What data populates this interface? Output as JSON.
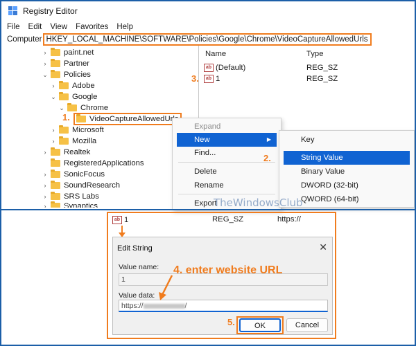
{
  "window": {
    "title": "Registry Editor"
  },
  "menubar": [
    "File",
    "Edit",
    "View",
    "Favorites",
    "Help"
  ],
  "address": {
    "label": "Computer",
    "path": "HKEY_LOCAL_MACHINE\\SOFTWARE\\Policies\\Google\\Chrome\\VideoCaptureAllowedUrls"
  },
  "tree": [
    {
      "label": "paint.net",
      "chev": "›"
    },
    {
      "label": "Partner",
      "chev": "›"
    },
    {
      "label": "Policies",
      "chev": "⌄"
    },
    {
      "label": "Adobe",
      "chev": "›"
    },
    {
      "label": "Google",
      "chev": "⌄"
    },
    {
      "label": "Chrome",
      "chev": "⌄"
    },
    {
      "label": "VideoCaptureAllowedUrls",
      "chev": ""
    },
    {
      "label": "Microsoft",
      "chev": "›"
    },
    {
      "label": "Mozilla",
      "chev": "›"
    },
    {
      "label": "Realtek",
      "chev": "›"
    },
    {
      "label": "RegisteredApplications",
      "chev": ""
    },
    {
      "label": "SonicFocus",
      "chev": "›"
    },
    {
      "label": "SoundResearch",
      "chev": "›"
    },
    {
      "label": "SRS Labs",
      "chev": "›"
    },
    {
      "label": "Synaptics",
      "chev": "›"
    }
  ],
  "values": {
    "headers": {
      "name": "Name",
      "type": "Type"
    },
    "rows": [
      {
        "name": "(Default)",
        "type": "REG_SZ"
      },
      {
        "name": "1",
        "type": "REG_SZ"
      }
    ]
  },
  "context_menu": {
    "items": [
      "Expand",
      "New",
      "Find...",
      "Delete",
      "Rename",
      "Export"
    ],
    "disabled": "Expand",
    "highlighted": "New"
  },
  "submenu": {
    "items": [
      "Key",
      "String Value",
      "Binary Value",
      "DWORD (32-bit)",
      "QWORD (64-bit)"
    ],
    "highlighted": "String Value"
  },
  "steps": {
    "s1": "1.",
    "s2": "2.",
    "s3": "3.",
    "s4": "4. enter website URL",
    "s5": "5."
  },
  "icons": {
    "value": "ab"
  },
  "watermark": "TheWindowsClub",
  "preview_row": {
    "name": "1",
    "type": "REG_SZ",
    "data": "https://"
  },
  "dialog": {
    "title": "Edit String",
    "close": "✕",
    "value_name_label": "Value name:",
    "value_name": "1",
    "value_data_label": "Value data:",
    "value_data_prefix": "https://",
    "value_data_suffix": "/",
    "ok": "OK",
    "cancel": "Cancel"
  },
  "colors": {
    "accent": "#1063d2",
    "annotation": "#f07c1e",
    "frame": "#1c5fa8"
  }
}
